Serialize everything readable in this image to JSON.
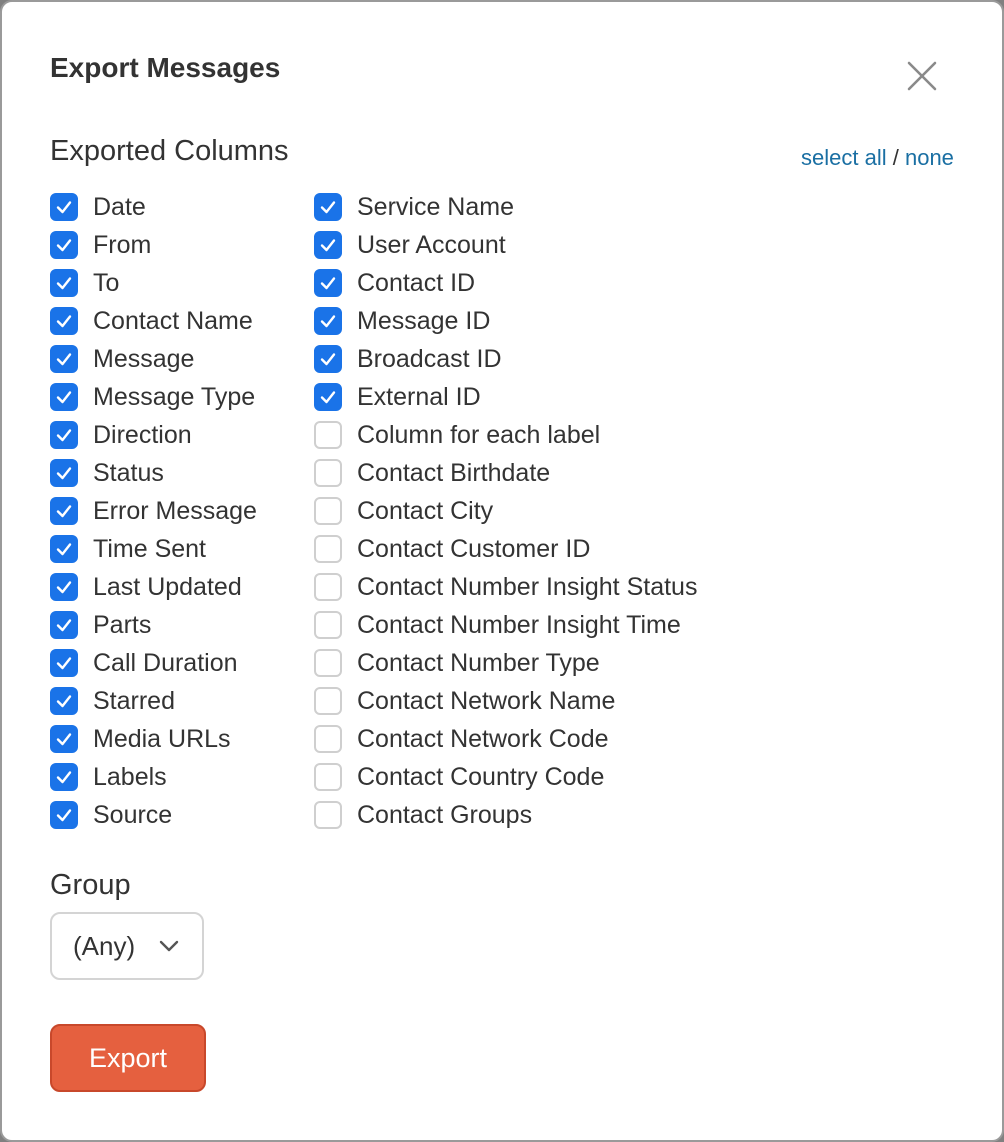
{
  "dialog": {
    "title": "Export Messages",
    "close_icon": "close-icon"
  },
  "columns": {
    "heading": "Exported Columns",
    "select_all": "select all",
    "separator": "/",
    "select_none": "none",
    "check_color": "#1a73e8",
    "left": [
      {
        "label": "Date",
        "checked": true
      },
      {
        "label": "From",
        "checked": true
      },
      {
        "label": "To",
        "checked": true
      },
      {
        "label": "Contact Name",
        "checked": true
      },
      {
        "label": "Message",
        "checked": true
      },
      {
        "label": "Message Type",
        "checked": true
      },
      {
        "label": "Direction",
        "checked": true
      },
      {
        "label": "Status",
        "checked": true
      },
      {
        "label": "Error Message",
        "checked": true
      },
      {
        "label": "Time Sent",
        "checked": true
      },
      {
        "label": "Last Updated",
        "checked": true
      },
      {
        "label": "Parts",
        "checked": true
      },
      {
        "label": "Call Duration",
        "checked": true
      },
      {
        "label": "Starred",
        "checked": true
      },
      {
        "label": "Media URLs",
        "checked": true
      },
      {
        "label": "Labels",
        "checked": true
      },
      {
        "label": "Source",
        "checked": true
      }
    ],
    "right": [
      {
        "label": "Service Name",
        "checked": true
      },
      {
        "label": "User Account",
        "checked": true
      },
      {
        "label": "Contact ID",
        "checked": true
      },
      {
        "label": "Message ID",
        "checked": true
      },
      {
        "label": "Broadcast ID",
        "checked": true
      },
      {
        "label": "External ID",
        "checked": true
      },
      {
        "label": "Column for each label",
        "checked": false
      },
      {
        "label": "Contact Birthdate",
        "checked": false
      },
      {
        "label": "Contact City",
        "checked": false
      },
      {
        "label": "Contact Customer ID",
        "checked": false
      },
      {
        "label": "Contact Number Insight Status",
        "checked": false
      },
      {
        "label": "Contact Number Insight Time",
        "checked": false
      },
      {
        "label": "Contact Number Type",
        "checked": false
      },
      {
        "label": "Contact Network Name",
        "checked": false
      },
      {
        "label": "Contact Network Code",
        "checked": false
      },
      {
        "label": "Contact Country Code",
        "checked": false
      },
      {
        "label": "Contact Groups",
        "checked": false
      }
    ]
  },
  "group": {
    "label": "Group",
    "selected": "(Any)",
    "chevron_icon": "chevron-down-icon"
  },
  "actions": {
    "export_label": "Export",
    "export_color": "#e5603f"
  }
}
